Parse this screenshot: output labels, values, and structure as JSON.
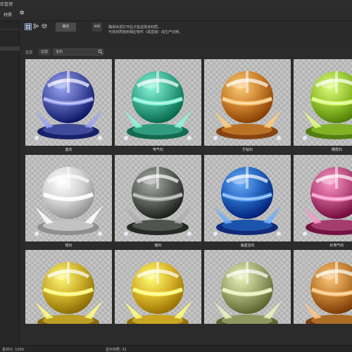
{
  "window": {
    "title": "库管理"
  },
  "menubar": {
    "item": "材质",
    "settings_icon": "gear-icon"
  },
  "toolbar": {
    "view_icons": [
      "grid-view-icon",
      "node-view-icon",
      "package-icon"
    ],
    "confirm_label": "确定",
    "kw_label": "KW",
    "hint_line1": "确保资源打开后才能选择该材质。",
    "hint_line2": "可将材质拖到相应物件（或直接）成生产切换。"
  },
  "filter": {
    "label": "过滤",
    "tag": "过滤",
    "search_value": "宝石"
  },
  "materials": [
    {
      "name": "蓝石",
      "color": "#4b55a6"
    },
    {
      "name": "电气石",
      "color": "#3aa88a"
    },
    {
      "name": "方钴石",
      "color": "#c77d2a"
    },
    {
      "name": "橄榄石",
      "color": "#8fbe2d"
    },
    {
      "name": "锆石",
      "color": "#d0d0d0"
    },
    {
      "name": "锗石",
      "color": "#5b5f5a"
    },
    {
      "name": "海蓝宝石",
      "color": "#1f5fb8"
    },
    {
      "name": "红电气石",
      "color": "#b2477a"
    },
    {
      "name": "",
      "color": "#c9ab28"
    },
    {
      "name": "",
      "color": "#d6b126"
    },
    {
      "name": "",
      "color": "#9aa46b"
    },
    {
      "name": "",
      "color": "#b9782c"
    }
  ],
  "status": {
    "left": "素材计: 1500",
    "right": "显示材质: 32"
  }
}
